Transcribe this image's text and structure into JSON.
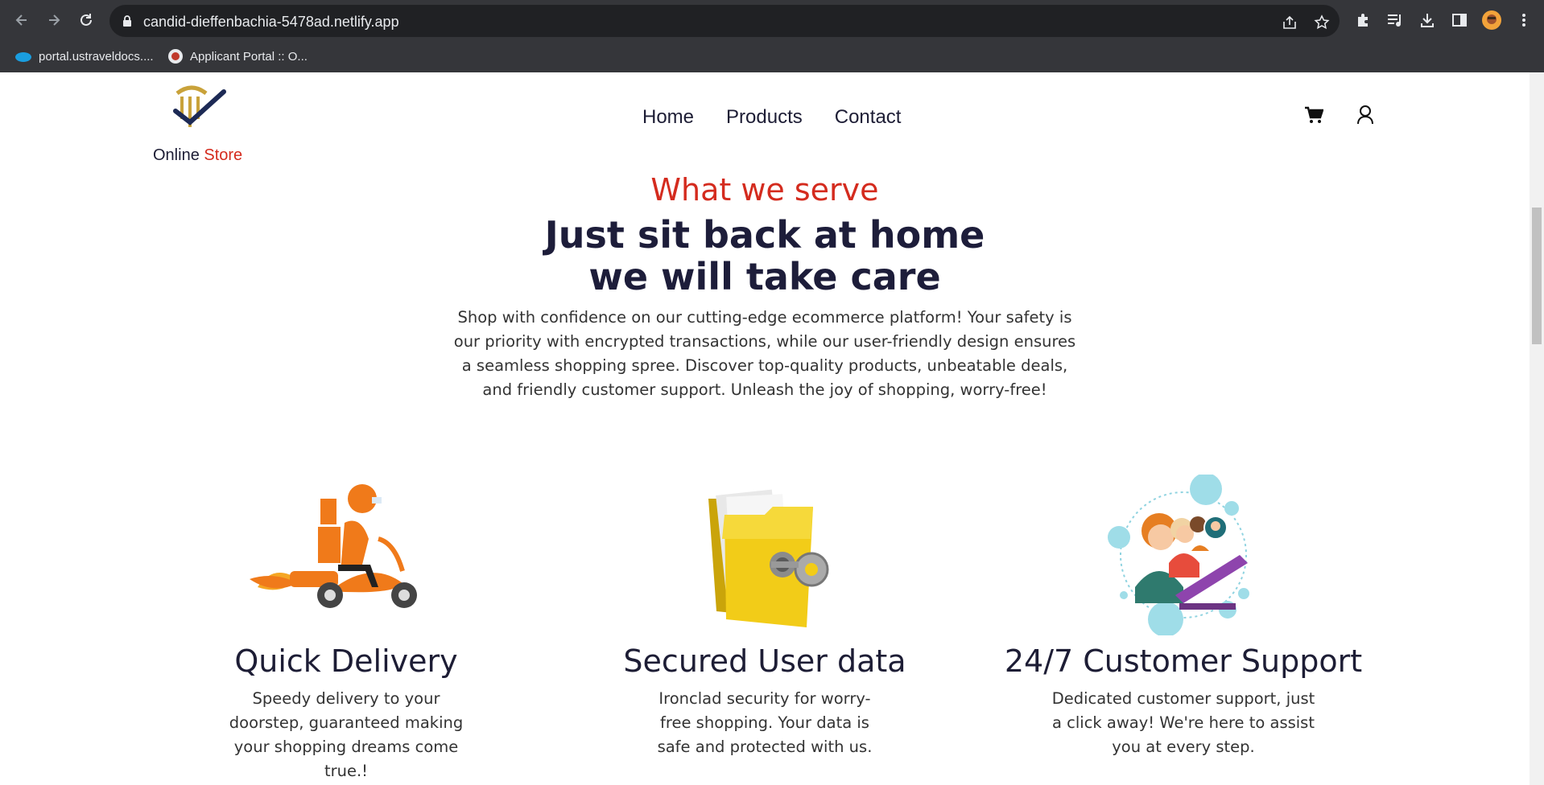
{
  "browser": {
    "url": "candid-dieffenbachia-5478ad.netlify.app",
    "bookmarks": [
      {
        "label": "portal.ustraveldocs...."
      },
      {
        "label": "Applicant Portal :: O..."
      }
    ]
  },
  "header": {
    "logo_text_main": "Online",
    "logo_text_accent": "Store",
    "nav": [
      "Home",
      "Products",
      "Contact"
    ],
    "icons": [
      "cart-icon",
      "user-icon"
    ]
  },
  "hero": {
    "tag": "What we serve",
    "headline_line1": "Just sit back at home",
    "headline_line2": "we will take care",
    "intro": "Shop with confidence on our cutting-edge ecommerce platform! Your safety is our priority with encrypted transactions, while our user-friendly design ensures a seamless shopping spree. Discover top-quality products, unbeatable deals, and friendly customer support. Unleash the joy of shopping, worry-free!"
  },
  "features": [
    {
      "title": "Quick Delivery",
      "text": "Speedy delivery to your doorstep, guaranteed making your shopping dreams come true.!",
      "icon": "delivery-scooter-illustration"
    },
    {
      "title": "Secured User data",
      "text": "Ironclad security for worry-free shopping. Your data is safe and protected with us.",
      "icon": "locked-folder-illustration"
    },
    {
      "title": "24/7 Customer Support",
      "text": "Dedicated customer support, just a click away! We're here to assist you at every step.",
      "icon": "support-agents-illustration"
    }
  ],
  "colors": {
    "accent": "#d42b1e",
    "heading": "#1d1d3a",
    "chrome": "#35363a"
  }
}
